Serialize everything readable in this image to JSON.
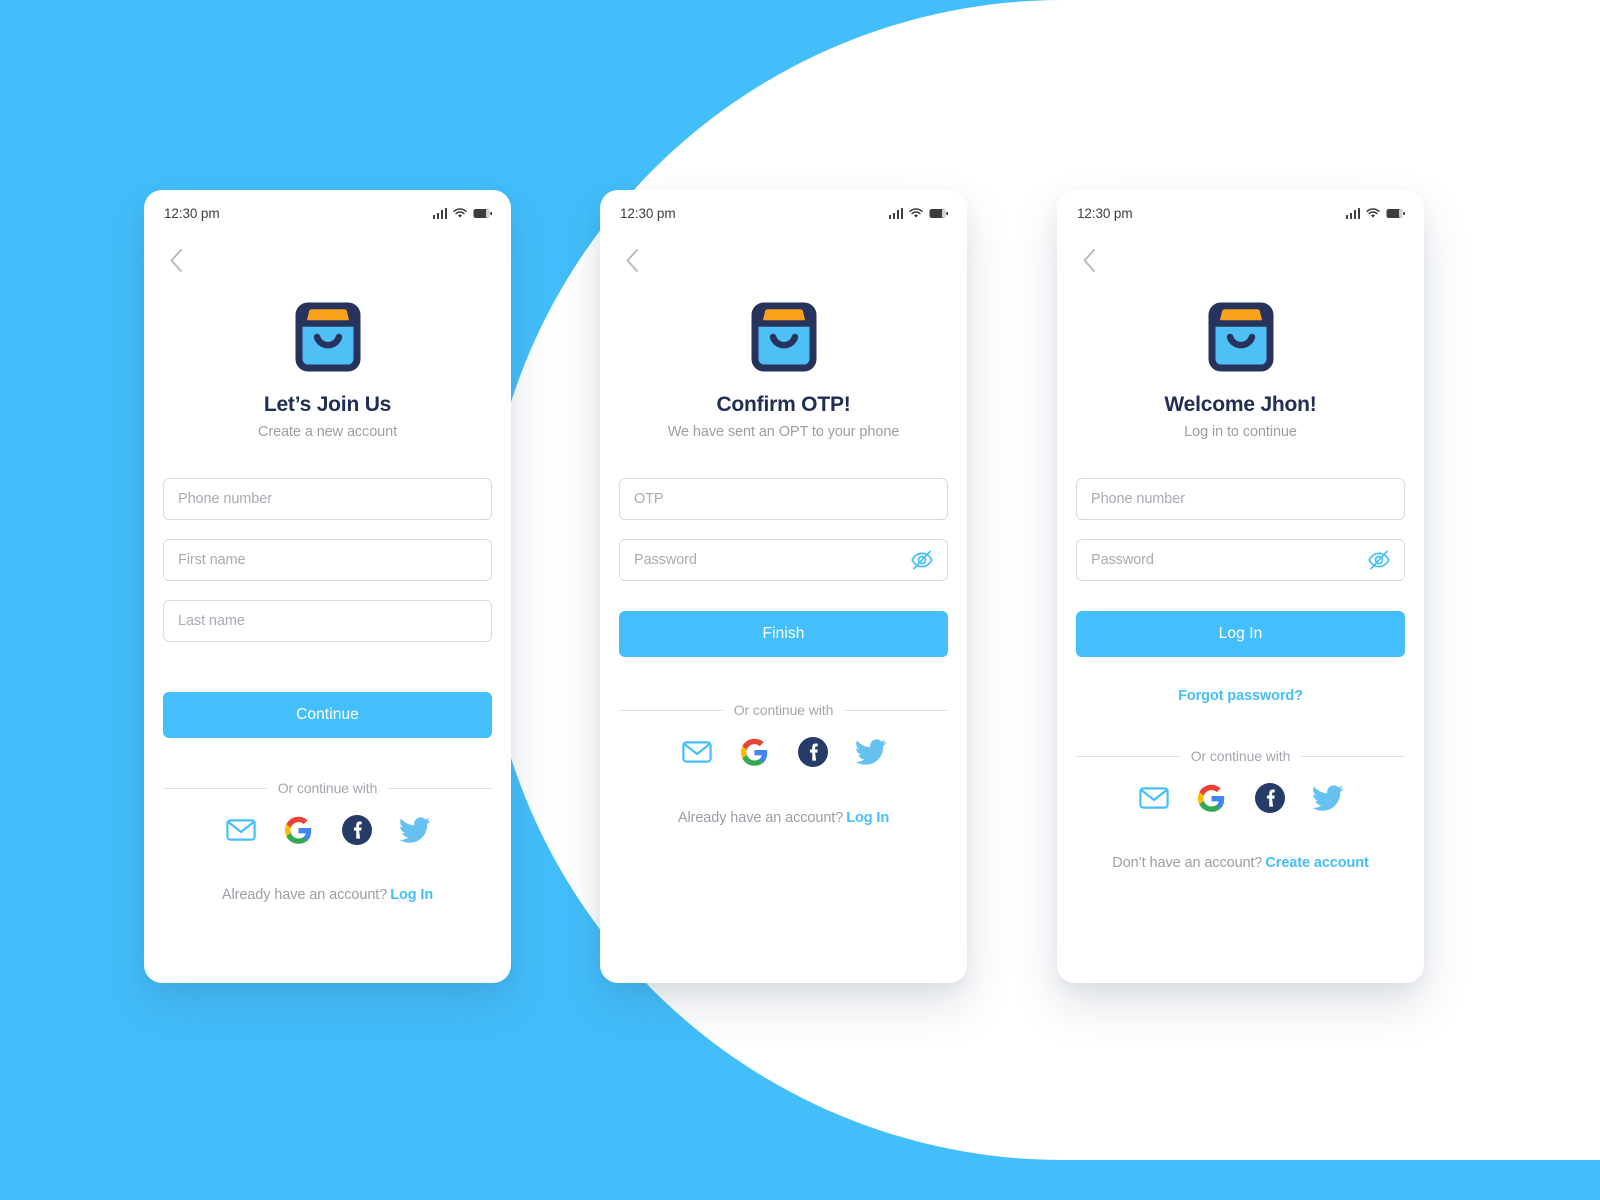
{
  "theme": {
    "background_blue": "#42BEFB",
    "accent_blue": "#45BFFB",
    "title_navy": "#212F54",
    "muted_gray": "#9B9EA5",
    "logo_orange": "#FAA21B",
    "logo_blue": "#4FC0F5",
    "logo_navy": "#27335C"
  },
  "status_bar": {
    "time": "12:30 pm",
    "signal_icon": "signal-bars-icon",
    "wifi_icon": "wifi-icon",
    "battery_icon": "battery-icon"
  },
  "common": {
    "back_icon": "chevron-left-icon",
    "logo_icon": "shopping-bag-logo-icon",
    "divider_label": "Or continue with",
    "socials": [
      {
        "name": "email",
        "icon": "email-icon",
        "label": "Email"
      },
      {
        "name": "google",
        "icon": "google-icon",
        "label": "Google"
      },
      {
        "name": "facebook",
        "icon": "facebook-icon",
        "label": "Facebook"
      },
      {
        "name": "twitter",
        "icon": "twitter-icon",
        "label": "Twitter"
      }
    ],
    "eye_off_icon": "eye-off-icon"
  },
  "screens": [
    {
      "id": "signup",
      "title": "Let’s Join Us",
      "subtitle": "Create a new account",
      "fields": [
        {
          "name": "phone-number",
          "placeholder": "Phone number",
          "value": ""
        },
        {
          "name": "first-name",
          "placeholder": "First name",
          "value": ""
        },
        {
          "name": "last-name",
          "placeholder": "Last name",
          "value": ""
        }
      ],
      "primary_button": "Continue",
      "footer_text": "Already have an account?",
      "footer_action": "Log In"
    },
    {
      "id": "confirm-otp",
      "title": "Confirm OTP!",
      "subtitle": "We have sent an OPT to your phone",
      "fields": [
        {
          "name": "otp",
          "placeholder": "OTP",
          "value": ""
        },
        {
          "name": "password",
          "placeholder": "Password",
          "value": ""
        }
      ],
      "primary_button": "Finish",
      "footer_text": "Already have an account?",
      "footer_action": "Log In"
    },
    {
      "id": "login",
      "title": "Welcome Jhon!",
      "subtitle": "Log in to continue",
      "fields": [
        {
          "name": "phone-number",
          "placeholder": "Phone number",
          "value": ""
        },
        {
          "name": "password",
          "placeholder": "Password",
          "value": ""
        }
      ],
      "primary_button": "Log In",
      "forgot_password": "Forgot password?",
      "footer_text": "Don’t have an account?",
      "footer_action": "Create account"
    }
  ]
}
